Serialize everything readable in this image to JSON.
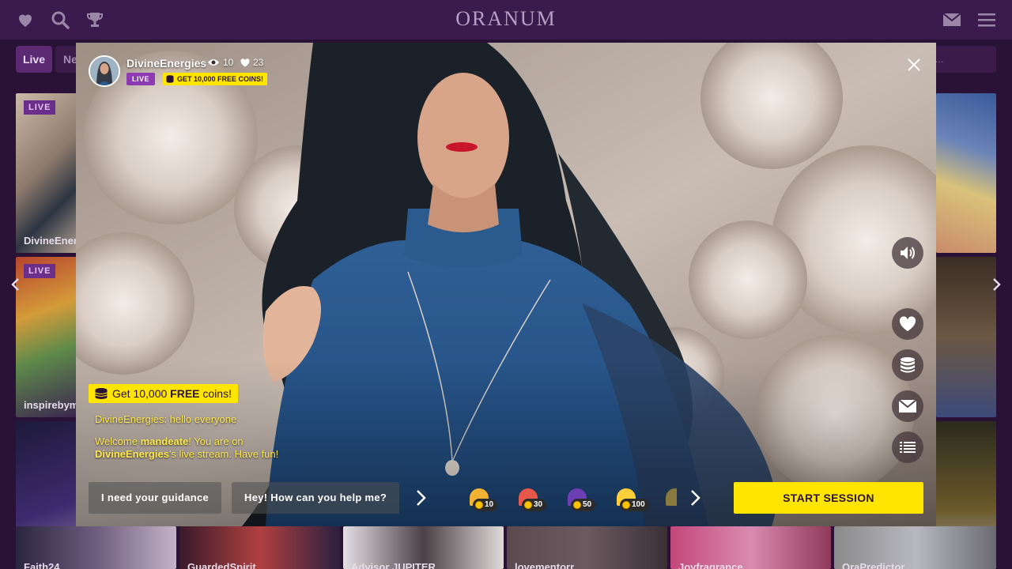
{
  "app": {
    "logo": "ORANUM"
  },
  "topbar": {
    "left_icons": [
      "heart-icon",
      "search-icon",
      "trophy-icon"
    ],
    "right_icons": [
      "envelope-icon",
      "menu-icon"
    ]
  },
  "filters": {
    "live_label": "Live",
    "new_label": "Ne",
    "search_placeholder": "s..."
  },
  "background_cards": [
    {
      "name": "DivineEner",
      "badge": "LIVE"
    },
    {
      "name": "inspirebym",
      "badge": "LIVE"
    },
    {
      "name": "Faith24"
    },
    {
      "name": "GuardedSpirit"
    },
    {
      "name": "Advisor JUPITER"
    },
    {
      "name": "lovementorr"
    },
    {
      "name": "Joyfragrance"
    },
    {
      "name": "OraPredictor"
    }
  ],
  "modal": {
    "performer": {
      "name": "DivineEnergies",
      "viewers": "10",
      "likes": "23",
      "live_badge": "LIVE",
      "coins_badge": "GET 10,000 FREE COINS!"
    },
    "banner": {
      "prefix": "Get 10,000 ",
      "bold": "FREE",
      "suffix": " coins!"
    },
    "chat": {
      "line1": "DivineEnergies: hello everyone",
      "welcome_pre": "Welcome ",
      "welcome_user": "mandeate",
      "welcome_mid": "! You are on",
      "welcome_performer": "DivineEnergies",
      "welcome_post": "'s live stream. Have fun!"
    },
    "quick_replies": [
      "I need your guidance",
      "Hey! How can you help me?"
    ],
    "gifts": [
      {
        "price": "10",
        "color": "#f2b233"
      },
      {
        "price": "30",
        "color": "#e8584a"
      },
      {
        "price": "50",
        "color": "#6c3fb5"
      },
      {
        "price": "100",
        "color": "#ffcf3a"
      }
    ],
    "start_button": "START SESSION",
    "side_buttons": [
      "speaker-icon",
      "heart-icon",
      "coins-icon",
      "envelope-icon",
      "list-icon"
    ]
  },
  "colors": {
    "brand_bg": "#2a1236",
    "topbar": "#3b1a4d",
    "accent_yellow": "#ffe500",
    "live_purple": "#8e3ab3"
  }
}
